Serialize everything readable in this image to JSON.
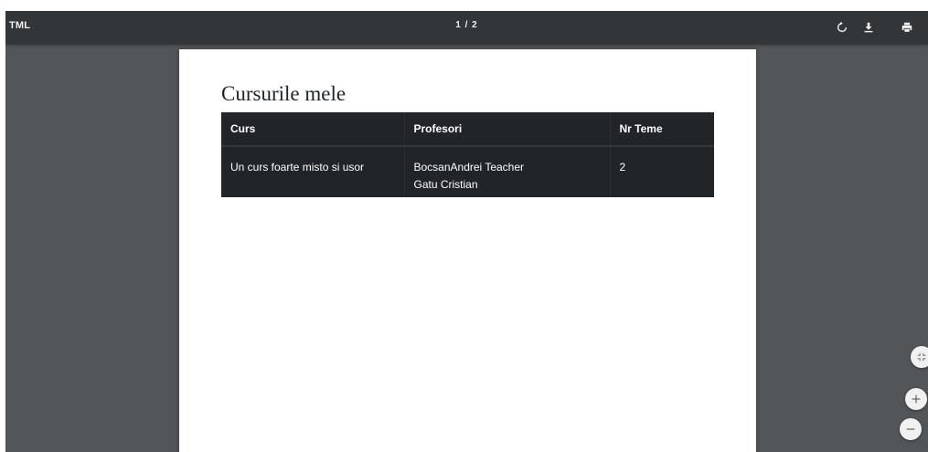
{
  "toolbar": {
    "title": "TML",
    "page_indicator": "1 / 2",
    "icons": {
      "rotate": "rotate-icon",
      "download": "download-icon",
      "print": "print-icon"
    }
  },
  "document": {
    "heading": "Cursurile mele",
    "table": {
      "headers": [
        "Curs",
        "Profesori",
        "Nr Teme"
      ],
      "rows": [
        {
          "curs": "Un curs foarte misto si usor",
          "profesori": [
            "BocsanAndrei Teacher",
            "Gatu Cristian"
          ],
          "nr_teme": "2"
        }
      ]
    }
  },
  "controls": {
    "fit_icon": "fit-to-page-icon",
    "zoom_in_icon": "plus-icon",
    "zoom_out_icon": "minus-icon"
  },
  "colors": {
    "viewer_background": "#525659",
    "toolbar_background": "#323639",
    "table_background": "#212529",
    "page_background": "#ffffff"
  }
}
